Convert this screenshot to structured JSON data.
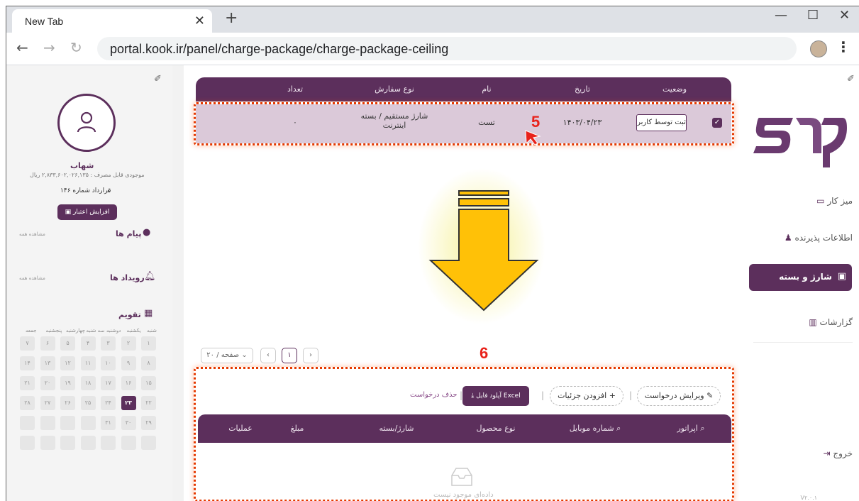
{
  "browser": {
    "tab_title": "New Tab",
    "url": "portal.kook.ir/panel/charge-package/charge-package-ceiling"
  },
  "left_panel": {
    "user_name": "شهاب",
    "balance": "موجودی قابل مصرف : ۲,۸۳۳,۶۰۲,۰۲۶,۱۳۵ ریال",
    "contract": "قرارداد شماره ۱۴۶",
    "increase_credit": "افزایش اعتبار",
    "messages": "پیام ها",
    "see_all": "مشاهده همه",
    "events": "رویداد ها",
    "calendar": "تقویم",
    "weekdays": [
      "شنبه",
      "یکشنبه",
      "دوشنبه",
      "سه شنبه",
      "چهارشنبه",
      "پنجشنبه",
      "جمعه"
    ],
    "calendar_days": [
      "۱",
      "۲",
      "۳",
      "۴",
      "۵",
      "۶",
      "۷",
      "۸",
      "۹",
      "۱۰",
      "۱۱",
      "۱۲",
      "۱۳",
      "۱۴",
      "۱۵",
      "۱۶",
      "۱۷",
      "۱۸",
      "۱۹",
      "۲۰",
      "۲۱",
      "۲۲",
      "۲۳",
      "۲۴",
      "۲۵",
      "۲۶",
      "۲۷",
      "۲۸",
      "۲۹",
      "۳۰",
      "۳۱"
    ],
    "today": "۲۳"
  },
  "table": {
    "headers": [
      "وضعیت",
      "تاریخ",
      "نام",
      "نوع سفارش",
      "تعداد"
    ],
    "row": {
      "status": "ثبت توسط کاربر",
      "date": "۱۴۰۳/۰۴/۲۳",
      "name": "تست",
      "order_type": "شارژ مستقیم / بسته اینترنت",
      "count": "۰"
    }
  },
  "annotations": {
    "five": "5",
    "six": "6"
  },
  "pagination": {
    "page": "۱",
    "per_page": "۲۰ / صفحه"
  },
  "details": {
    "edit_request": "ویرایش درخواست",
    "add_details": "افزودن جزئیات",
    "upload_excel": "آپلود فایل Excel",
    "delete_request": "حذف درخواست",
    "headers": [
      "اپراتور",
      "شماره موبایل",
      "نوع محصول",
      "شارژ/بسته",
      "مبلغ",
      "عملیات"
    ],
    "empty": "داده‌ای موجود نیست"
  },
  "right_panel": {
    "nav": [
      "میز کار",
      "اطلاعات پذیرنده",
      "شارژ و بسته",
      "گزارشات"
    ],
    "logout": "خروج",
    "version": "V۲.۰.۱"
  },
  "colors": {
    "brand": "#5c2f5c",
    "annotation": "#e53900",
    "arrow": "#ffc107"
  }
}
